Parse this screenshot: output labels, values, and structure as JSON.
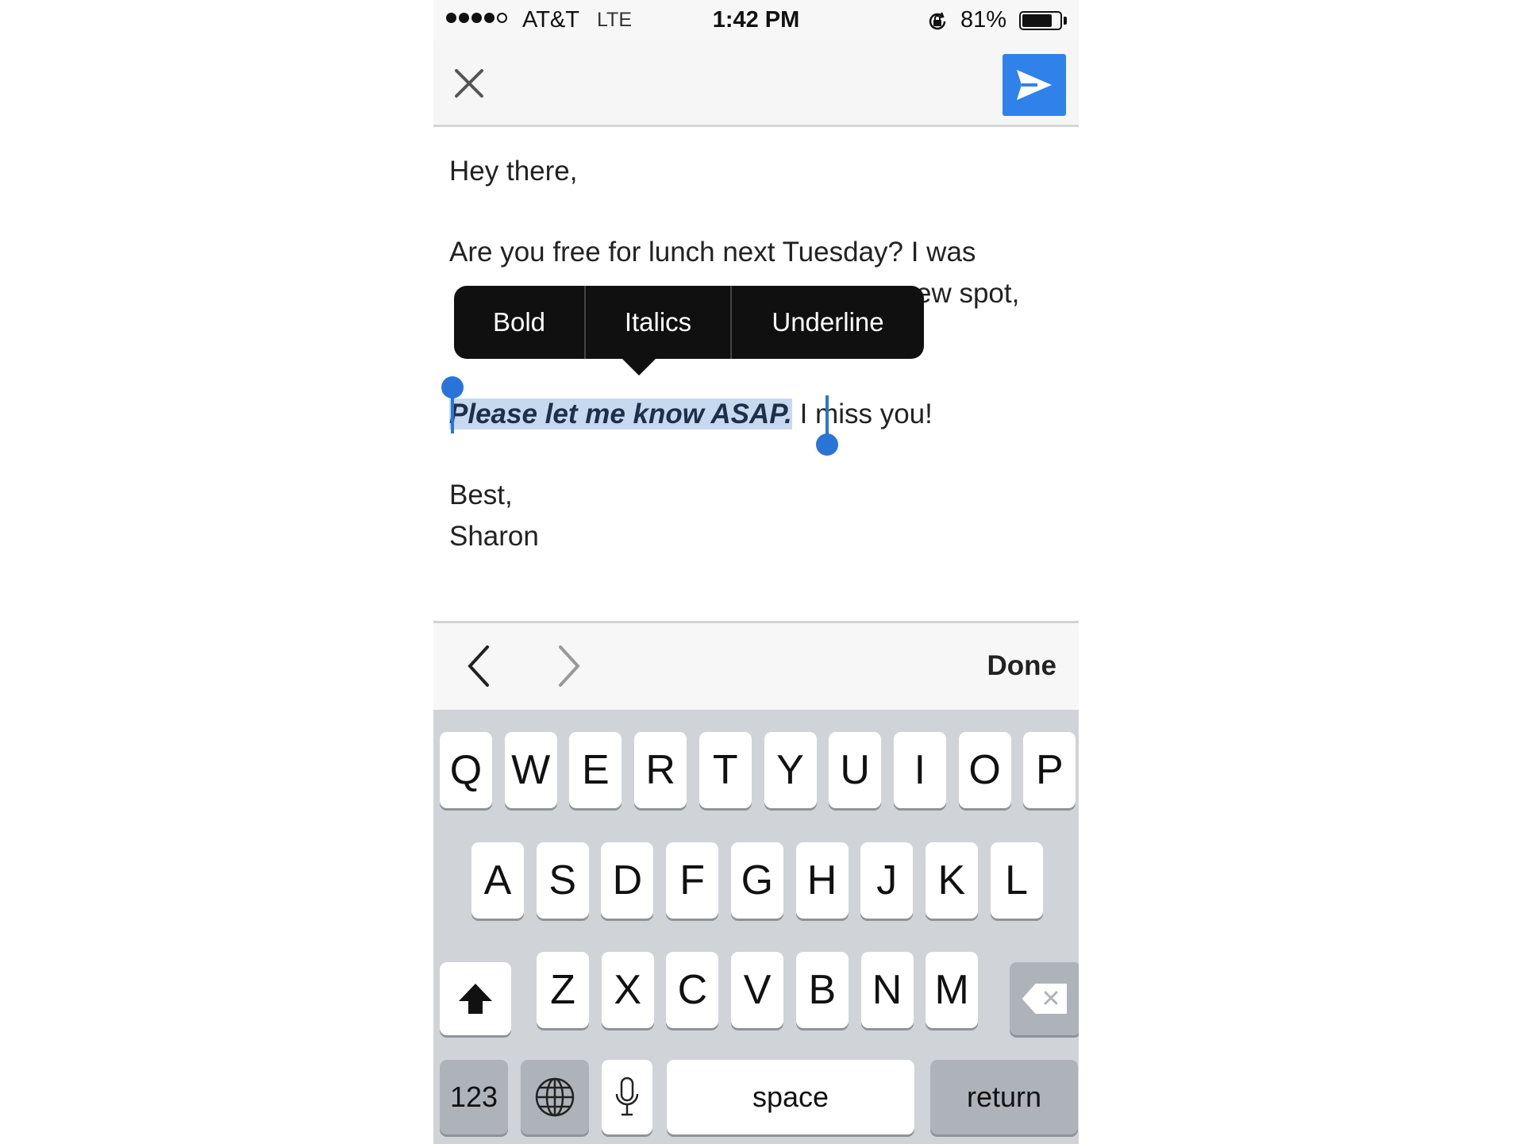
{
  "status_bar": {
    "carrier": "AT&T",
    "network": "LTE",
    "time": "1:42 PM",
    "battery": "81%",
    "battery_level": 0.81,
    "signal_bars": 4
  },
  "nav": {
    "close_icon": "close-icon",
    "send_icon": "send-icon",
    "accent_color": "#2f82ea"
  },
  "compose": {
    "greeting": "Hey there,",
    "line1": "Are you free for lunch next Tuesday? I was",
    "line2_tail": "ew spot,",
    "selected": "Please let me know ASAP.",
    "after_selected": " I miss you!",
    "signoff": "Best,",
    "name": "Sharon"
  },
  "format_menu": {
    "bold": "Bold",
    "italics": "Italics",
    "underline": "Underline"
  },
  "accessory": {
    "done": "Done"
  },
  "keyboard": {
    "row1": [
      "Q",
      "W",
      "E",
      "R",
      "T",
      "Y",
      "U",
      "I",
      "O",
      "P"
    ],
    "row2": [
      "A",
      "S",
      "D",
      "F",
      "G",
      "H",
      "J",
      "K",
      "L"
    ],
    "row3": [
      "Z",
      "X",
      "C",
      "V",
      "B",
      "N",
      "M"
    ],
    "numbers": "123",
    "space": "space",
    "return": "return"
  }
}
